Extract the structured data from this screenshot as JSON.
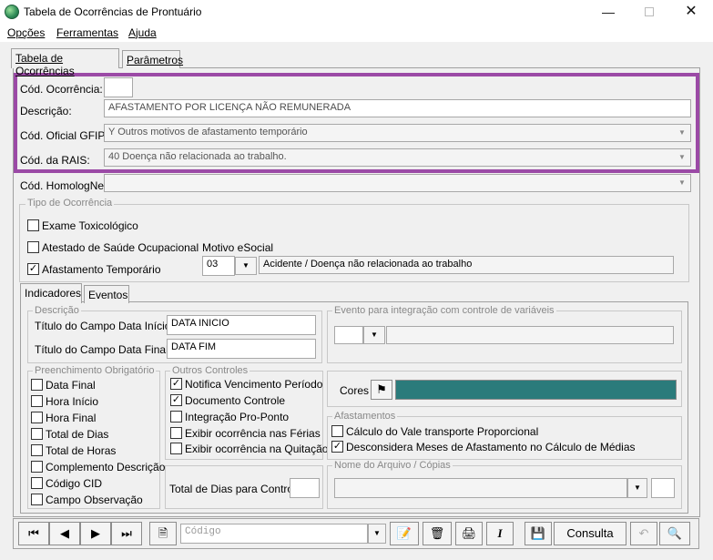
{
  "window": {
    "title": "Tabela de Ocorrências de Prontuário",
    "min_icon": "minimize-icon",
    "max_icon": "maximize-icon",
    "close_icon": "close-icon"
  },
  "menu": [
    "Opções",
    "Ferramentas",
    "Ajuda"
  ],
  "tabs": [
    "Tabela de Ocorrências",
    "Parâmetros"
  ],
  "form": {
    "cod_ocorrencia_label": "Cód. Ocorrência:",
    "cod_ocorrencia_value": "",
    "descricao_label": "Descrição:",
    "descricao_value": "AFASTAMENTO POR LICENÇA NÃO REMUNERADA",
    "gfip_label": "Cód. Oficial GFIP:",
    "gfip_value": "Y  Outros motivos de afastamento temporário",
    "rais_label": "Cód. da RAIS:",
    "rais_value": "40 Doença não relacionada ao trabalho.",
    "homolognet_label": "Cód. HomologNet:",
    "homolognet_value": ""
  },
  "tipo_ocorrencia": {
    "title": "Tipo de Ocorrência",
    "items": [
      {
        "label": "Exame Toxicológico",
        "checked": false
      },
      {
        "label": "Atestado de Saúde Ocupacional",
        "checked": false
      },
      {
        "label": "Afastamento Temporário",
        "checked": true
      }
    ],
    "motivo_label": "Motivo eSocial",
    "motivo_code": "03",
    "motivo_desc": "Acidente / Doença não relacionada ao trabalho"
  },
  "subtabs": [
    "Indicadores",
    "Eventos"
  ],
  "descricao_group": {
    "title": "Descrição",
    "inicio_label": "Título do Campo Data Início:",
    "inicio_value": "DATA INICIO",
    "final_label": "Título do Campo Data Final:",
    "final_value": "DATA FIM"
  },
  "evento_group": {
    "title": "Evento para integração com controle de variáveis"
  },
  "preenchimento": {
    "title": "Preenchimento Obrigatório",
    "items": [
      {
        "label": "Data Final",
        "checked": false
      },
      {
        "label": "Hora Início",
        "checked": false
      },
      {
        "label": "Hora Final",
        "checked": false
      },
      {
        "label": "Total de Dias",
        "checked": false
      },
      {
        "label": "Total de Horas",
        "checked": false
      },
      {
        "label": "Complemento Descrição",
        "checked": false
      },
      {
        "label": "Código CID",
        "checked": false
      },
      {
        "label": "Campo Observação",
        "checked": false
      }
    ]
  },
  "outros": {
    "title": "Outros Controles",
    "items": [
      {
        "label": "Notifica Vencimento Período",
        "checked": true
      },
      {
        "label": "Documento Controle",
        "checked": true
      },
      {
        "label": "Integração Pro-Ponto",
        "checked": false
      },
      {
        "label": "Exibir ocorrência nas Férias",
        "checked": false
      },
      {
        "label": "Exibir ocorrência na Quitação",
        "checked": false
      }
    ]
  },
  "total_dias_label": "Total de Dias para Controle:",
  "cores_label": "Cores",
  "cores_color": "#2b7b7b",
  "afastamentos": {
    "title": "Afastamentos",
    "items": [
      {
        "label": "Cálculo do Vale transporte Proporcional",
        "checked": false
      },
      {
        "label": "Desconsidera Meses de Afastamento no Cálculo de Médias",
        "checked": true
      }
    ]
  },
  "arquivo_group": {
    "title": "Nome do Arquivo / Cópias"
  },
  "toolbar": {
    "search_placeholder": "Código",
    "consulta_label": "Consulta"
  }
}
